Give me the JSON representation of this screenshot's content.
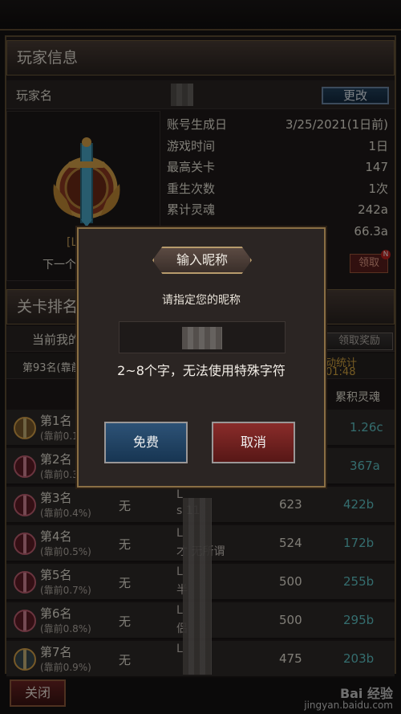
{
  "player_info": {
    "section_title": "玩家信息",
    "name_label": "玩家名",
    "change_button": "更改",
    "level_prefix": "[L",
    "next_prefix": "下一个",
    "claim_button": "领取",
    "claim_badge": "N",
    "stats": [
      {
        "label": "账号生成日",
        "value": "3/25/2021(1日前)"
      },
      {
        "label": "游戏时间",
        "value": "1日"
      },
      {
        "label": "最高关卡",
        "value": "147"
      },
      {
        "label": "重生次数",
        "value": "1次"
      },
      {
        "label": "累计灵魂",
        "value": "242a"
      },
      {
        "label": "",
        "value": "66.3a"
      }
    ]
  },
  "ranking": {
    "section_title": "关卡排名",
    "my_rank_label": "当前我的",
    "my_rank_value": "第93名(靠前",
    "claim_reward_button": "领取奖励",
    "stats_label": "动统计",
    "countdown": "01:48",
    "soul_header": "累积灵魂",
    "rows": [
      {
        "rank": "第1名",
        "sub": "(靠前0.1",
        "wu": "",
        "name1": "",
        "name2": "",
        "level": "",
        "soul": "1.26c"
      },
      {
        "rank": "第2名",
        "sub": "(靠前0.3",
        "wu": "",
        "name1": "",
        "name2": "",
        "level": "",
        "soul": "367a"
      },
      {
        "rank": "第3名",
        "sub": "(靠前0.4%)",
        "wu": "无",
        "name1": "L",
        "name2": "s   11",
        "level": "623",
        "soul": "422b"
      },
      {
        "rank": "第4名",
        "sub": "(靠前0.5%)",
        "wu": "无",
        "name1": "L",
        "name2": "才   无所谓",
        "level": "524",
        "soul": "172b"
      },
      {
        "rank": "第5名",
        "sub": "(靠前0.7%)",
        "wu": "无",
        "name1": "L",
        "name2": "半",
        "level": "500",
        "soul": "255b"
      },
      {
        "rank": "第6名",
        "sub": "(靠前0.8%)",
        "wu": "无",
        "name1": "L",
        "name2": "侣",
        "level": "500",
        "soul": "295b"
      },
      {
        "rank": "第7名",
        "sub": "(靠前0.9%)",
        "wu": "无",
        "name1": "L",
        "name2": "",
        "level": "475",
        "soul": "203b"
      }
    ]
  },
  "dialog": {
    "title": "输入昵称",
    "hint": "请指定您的昵称",
    "rule": "2~8个字，无法使用特殊字符",
    "free_button": "免费",
    "cancel_button": "取消"
  },
  "footer": {
    "close_button": "关闭",
    "watermark_line1": "Bai 经验",
    "watermark_line2": "jingyan.baidu.com"
  },
  "colors": {
    "accent_gold": "#8a6f44",
    "soul_teal": "#5fc7c9",
    "blue_button": "#22415c",
    "red_button": "#6c2423"
  }
}
